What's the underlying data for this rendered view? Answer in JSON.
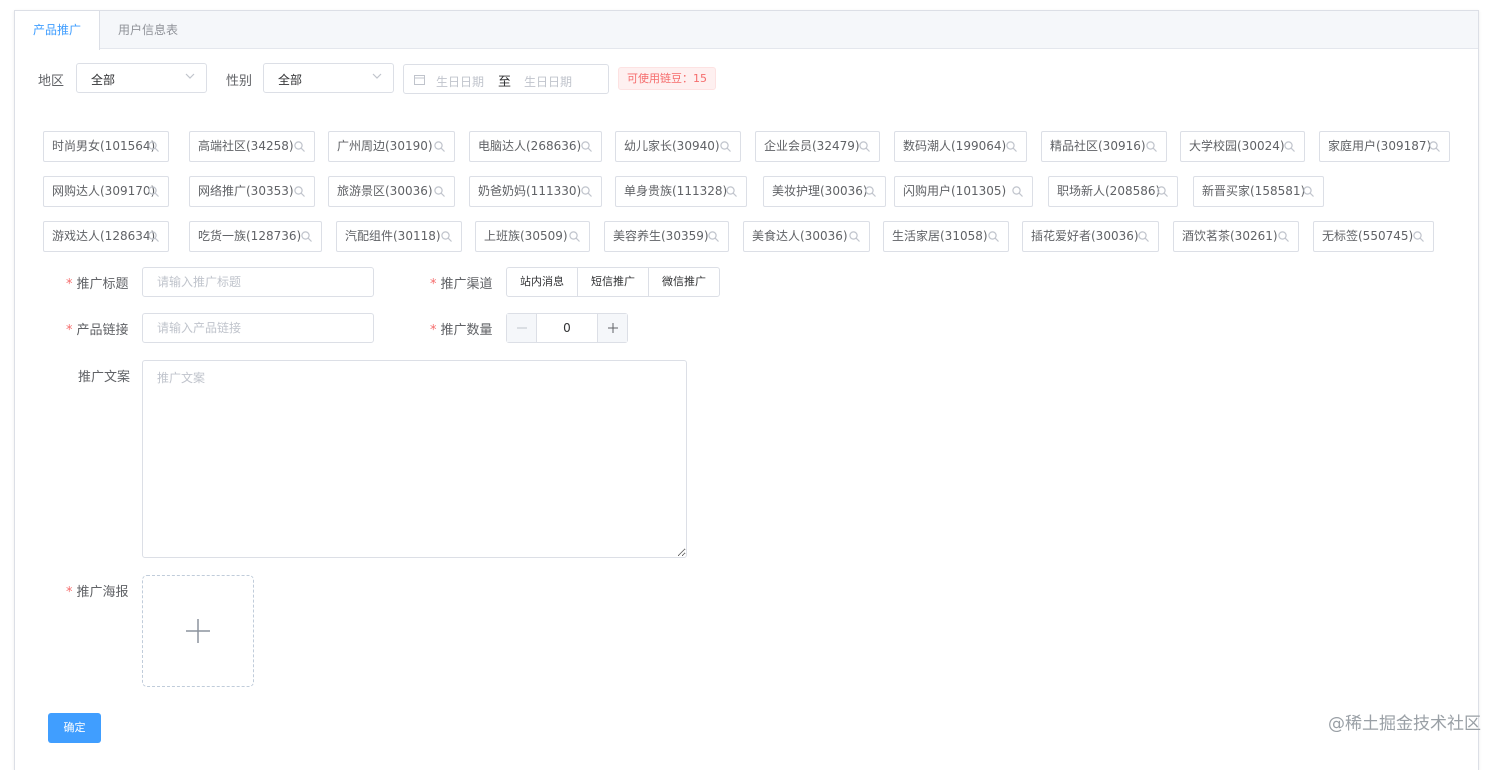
{
  "tabs": [
    {
      "label": "产品推广",
      "active": true
    },
    {
      "label": "用户信息表",
      "active": false
    }
  ],
  "filters": {
    "region_label": "地区",
    "region_value": "全部",
    "gender_label": "性别",
    "gender_value": "全部",
    "date_start_placeholder": "生日日期",
    "date_separator": "至",
    "date_end_placeholder": "生日日期",
    "beans_badge": "可使用链豆：15"
  },
  "tags": [
    "时尚男女(101564)",
    "高端社区(34258)",
    "广州周边(30190)",
    "电脑达人(268636)",
    "幼儿家长(30940)",
    "企业会员(32479)",
    "数码潮人(199064)",
    "精品社区(30916)",
    "大学校园(30024)",
    "家庭用户(309187)",
    "网购达人(309170)",
    "网络推广(30353)",
    "旅游景区(30036)",
    "奶爸奶妈(111330)",
    "单身贵族(111328)",
    "美妆护理(30036)",
    "闪购用户(101305)",
    "职场新人(208586)",
    "新晋买家(158581)",
    "游戏达人(128634)",
    "吃货一族(128736)",
    "汽配组件(30118)",
    "上班族(30509)",
    "美容养生(30359)",
    "美食达人(30036)",
    "生活家居(31058)",
    "插花爱好者(30036)",
    "酒饮茗茶(30261)",
    "无标签(550745)"
  ],
  "form": {
    "title_label": "推广标题",
    "title_placeholder": "请输入推广标题",
    "channel_label": "推广渠道",
    "channels": [
      "站内消息",
      "短信推广",
      "微信推广"
    ],
    "link_label": "产品链接",
    "link_placeholder": "请输入产品链接",
    "quantity_label": "推广数量",
    "quantity_value": "0",
    "copy_label": "推广文案",
    "copy_placeholder": "推广文案",
    "poster_label": "推广海报",
    "required_mark": "*",
    "submit_label": "确定"
  },
  "watermark": "@稀土掘金技术社区",
  "colors": {
    "primary": "#409eff",
    "danger": "#f56c6c",
    "border": "#dcdfe6"
  },
  "icons": [
    "chevron-down-icon",
    "calendar-icon",
    "search-icon",
    "plus-icon",
    "minus-icon"
  ]
}
